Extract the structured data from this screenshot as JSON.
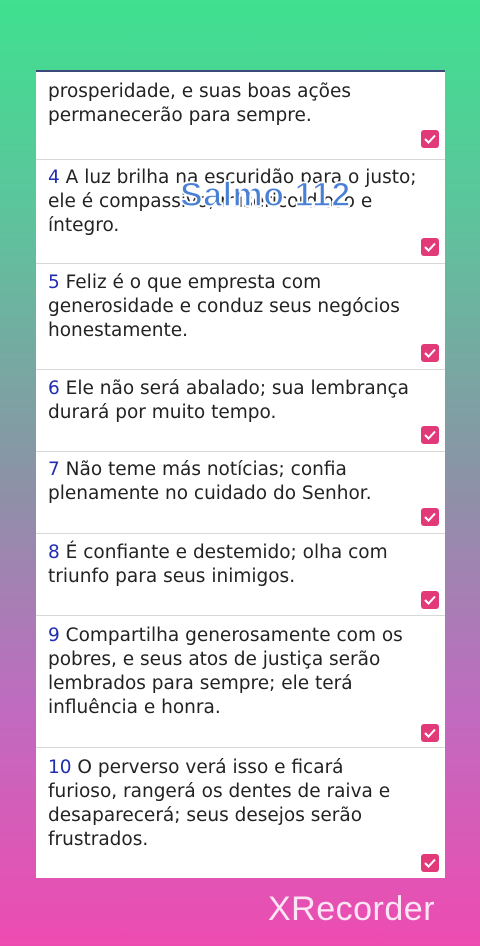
{
  "overlay": {
    "title": "Salmo 112",
    "watermark": "XRecorder"
  },
  "verses": [
    {
      "num": "",
      "text": "prosperidade, e suas boas ações permanecerão para sempre.",
      "checked": true
    },
    {
      "num": "4",
      "text": " A luz brilha na escuridão para o justo; ele é compassivo, misericordioso e íntegro.",
      "checked": true
    },
    {
      "num": "5",
      "text": " Feliz é o que empresta com generosidade e conduz seus negócios honestamente.",
      "checked": true
    },
    {
      "num": "6",
      "text": " Ele não será abalado; sua lembrança durará por muito tempo.",
      "checked": true
    },
    {
      "num": "7",
      "text": " Não teme más notícias; confia plenamente no cuidado do Senhor.",
      "checked": true
    },
    {
      "num": "8",
      "text": " É confiante e destemido; olha com triunfo para seus inimigos.",
      "checked": true
    },
    {
      "num": "9",
      "text": " Compartilha generosamente com os pobres, e seus atos de justiça serão lembrados para sempre; ele terá influência e honra.",
      "checked": true
    },
    {
      "num": "10",
      "text": " O perverso verá isso e ficará furioso, rangerá os dentes de raiva e desaparecerá; seus desejos serão frustrados.",
      "checked": true
    }
  ],
  "colors": {
    "check": "#e23a78",
    "verse_number": "#1f2fb0"
  }
}
